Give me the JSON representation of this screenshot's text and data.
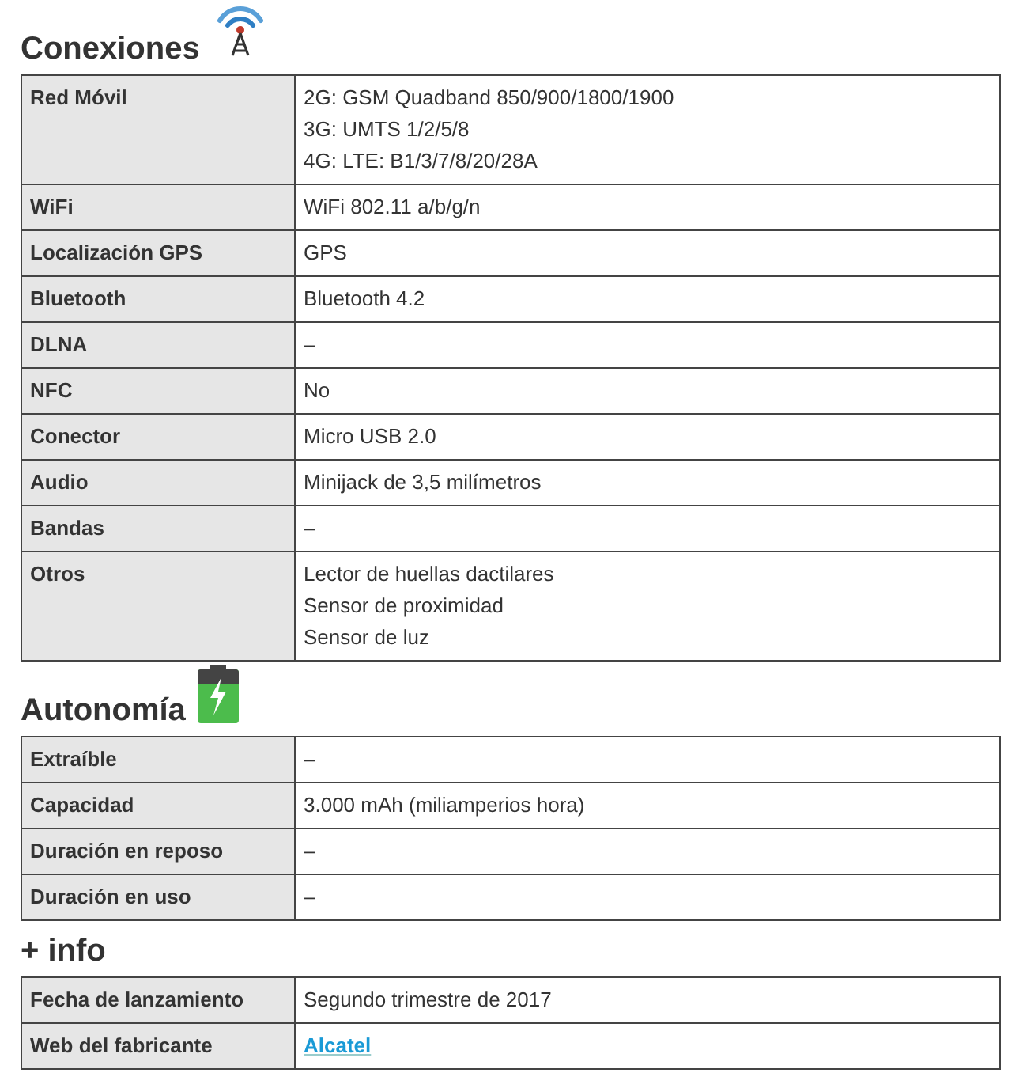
{
  "sections": [
    {
      "title": "Conexiones",
      "kind": "antenna",
      "rows": [
        {
          "label": "Red Móvil",
          "value": [
            {
              "kind": "text",
              "text": "2G: GSM Quadband 850/900/1800/1900"
            },
            {
              "kind": "text",
              "text": "3G: UMTS 1/2/5/8"
            },
            {
              "kind": "text",
              "text": "4G: LTE: B1/3/7/8/20/28A"
            }
          ]
        },
        {
          "label": "WiFi",
          "value": [
            {
              "kind": "text",
              "text": "WiFi 802.11 a/b/g/n"
            }
          ]
        },
        {
          "label": "Localización GPS",
          "value": [
            {
              "kind": "text",
              "text": "GPS"
            }
          ]
        },
        {
          "label": "Bluetooth",
          "value": [
            {
              "kind": "text",
              "text": "Bluetooth 4.2"
            }
          ]
        },
        {
          "label": "DLNA",
          "value": [
            {
              "kind": "text",
              "text": "–"
            }
          ]
        },
        {
          "label": "NFC",
          "value": [
            {
              "kind": "text",
              "text": "No"
            }
          ]
        },
        {
          "label": "Conector",
          "value": [
            {
              "kind": "text",
              "text": "Micro USB 2.0"
            }
          ]
        },
        {
          "label": "Audio",
          "value": [
            {
              "kind": "text",
              "text": "Minijack de 3,5 milímetros"
            }
          ]
        },
        {
          "label": "Bandas",
          "value": [
            {
              "kind": "text",
              "text": "–"
            }
          ]
        },
        {
          "label": "Otros",
          "value": [
            {
              "kind": "text",
              "text": "Lector de huellas dactilares"
            },
            {
              "kind": "text",
              "text": "Sensor de proximidad"
            },
            {
              "kind": "text",
              "text": "Sensor de luz"
            }
          ]
        }
      ]
    },
    {
      "title": "Autonomía",
      "kind": "battery",
      "rows": [
        {
          "label": "Extraíble",
          "value": [
            {
              "kind": "text",
              "text": "–"
            }
          ]
        },
        {
          "label": "Capacidad",
          "value": [
            {
              "kind": "text",
              "text": "3.000 mAh (miliamperios hora)"
            }
          ]
        },
        {
          "label": "Duración en reposo",
          "value": [
            {
              "kind": "text",
              "text": "–"
            }
          ]
        },
        {
          "label": "Duración en uso",
          "value": [
            {
              "kind": "text",
              "text": "–"
            }
          ]
        }
      ]
    },
    {
      "title": "+ info",
      "rows": [
        {
          "label": "Fecha de lanzamiento",
          "value": [
            {
              "kind": "text",
              "text": "Segundo trimestre de 2017"
            }
          ]
        },
        {
          "label": "Web del fabricante",
          "value": [
            {
              "kind": "link",
              "text": "Alcatel"
            }
          ]
        }
      ]
    }
  ]
}
